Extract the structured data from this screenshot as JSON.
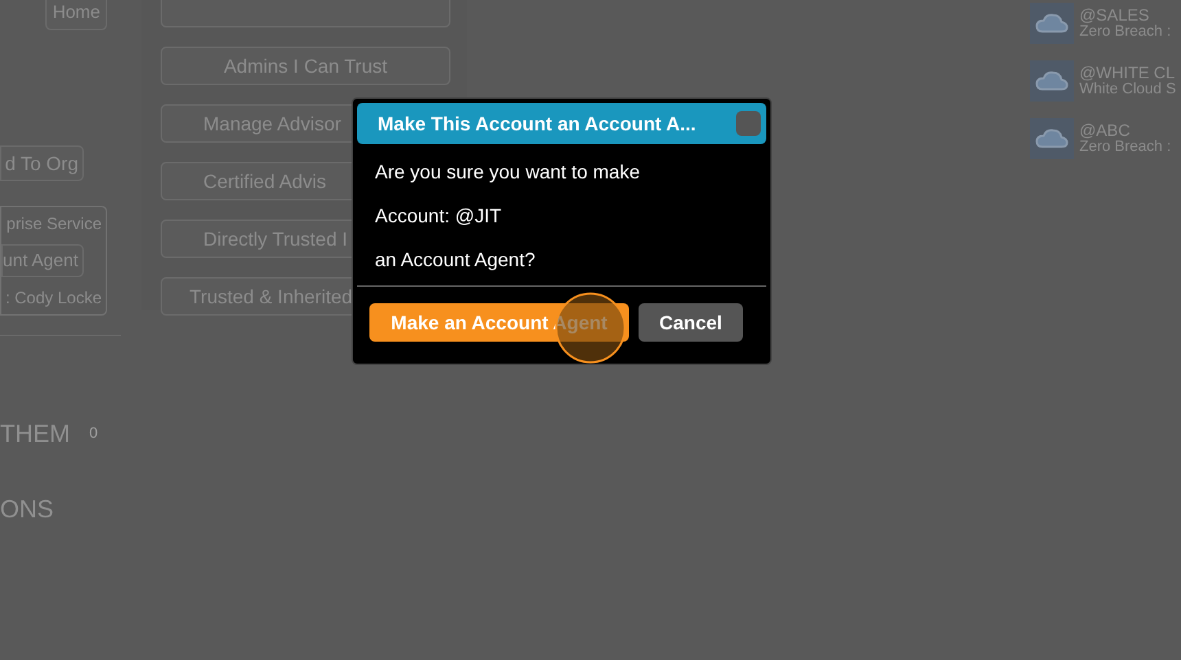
{
  "left_panel": {
    "home_button": "Home",
    "org_button": "d To Org",
    "group": {
      "line_1": "prise Service",
      "button": "unt Agent",
      "line_3": ": Cody Locke"
    },
    "sections": [
      {
        "label": "THEM",
        "count": "0"
      },
      {
        "label": "ONS"
      }
    ]
  },
  "menu_buttons": [
    {
      "label": "Admins I Can Trust"
    },
    {
      "label": "Manage Advisor"
    },
    {
      "label": "Certified Advis"
    },
    {
      "label": "Directly Trusted I"
    },
    {
      "label": "Trusted & Inherited"
    }
  ],
  "accounts": [
    {
      "name": "@SALES",
      "subtitle": "Zero Breach :"
    },
    {
      "name": "@WHITE CL",
      "subtitle": "White Cloud S"
    },
    {
      "name": "@ABC",
      "subtitle": "Zero Breach :"
    }
  ],
  "dialog": {
    "title": "Make This Account an Account A...",
    "lines": [
      "Are you sure you want to make",
      "Account: @JIT",
      "an Account Agent?"
    ],
    "confirm_button": "Make an Account Agent",
    "cancel_button": "Cancel"
  }
}
